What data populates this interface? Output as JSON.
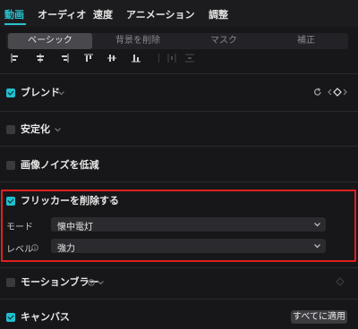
{
  "tabs": [
    {
      "label": "動画",
      "active": true
    },
    {
      "label": "オーディオ",
      "active": false
    },
    {
      "label": "速度",
      "active": false
    },
    {
      "label": "アニメーション",
      "active": false
    },
    {
      "label": "調整",
      "active": false
    }
  ],
  "subtabs": [
    {
      "label": "ベーシック",
      "active": true
    },
    {
      "label": "背景を削除",
      "active": false
    },
    {
      "label": "マスク",
      "active": false
    },
    {
      "label": "補正",
      "active": false
    }
  ],
  "sections": {
    "blend": {
      "label": "ブレンド",
      "checked": true
    },
    "stabilize": {
      "label": "安定化",
      "checked": false
    },
    "denoise": {
      "label": "画像ノイズを低減",
      "checked": false
    },
    "flicker": {
      "label": "フリッカーを削除する",
      "checked": true
    },
    "motion_blur": {
      "label": "モーションブラー",
      "checked": false
    },
    "canvas": {
      "label": "キャンバス",
      "checked": true
    }
  },
  "flicker_fields": {
    "mode_label": "モード",
    "mode_value": "懐中電灯",
    "level_label": "レベル",
    "level_value": "強力"
  },
  "apply_all_label": "すべてに適用",
  "colors": {
    "accent": "#27c3d0",
    "highlight_border": "#e0201f"
  }
}
